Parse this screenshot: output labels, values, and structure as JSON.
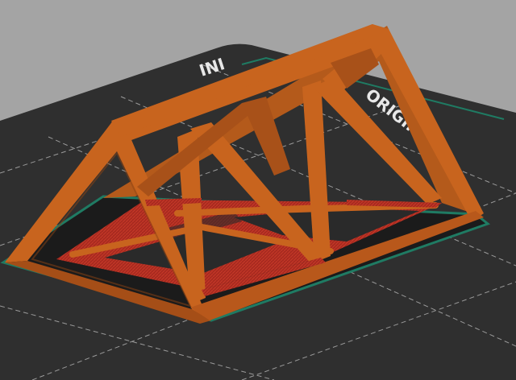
{
  "viewport": {
    "bed_label_left": "INI",
    "bed_label_right": "ORIGINAL"
  },
  "colors": {
    "background": "#a4a4a4",
    "bed": "#2f2f2f",
    "bed_grid": "#9a9a9a",
    "skirt": "#1f7b63",
    "model_orange": "#c8641e",
    "model_shadow": "#8e4413",
    "model_infill": "#b32a1e"
  }
}
